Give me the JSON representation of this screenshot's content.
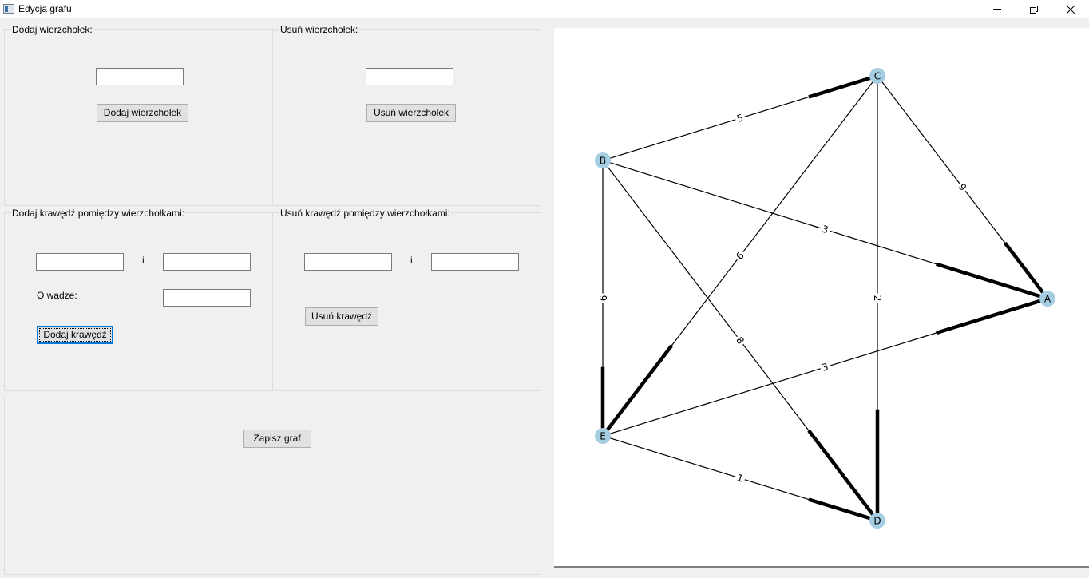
{
  "window": {
    "title": "Edycja grafu"
  },
  "add_vertex": {
    "title": "Dodaj wierzchołek:",
    "input_value": "",
    "button_label": "Dodaj wierzchołek"
  },
  "remove_vertex": {
    "title": "Usuń wierzchołek:",
    "input_value": "",
    "button_label": "Usuń wierzchołek"
  },
  "add_edge": {
    "title": "Dodaj krawędź pomiędzy wierzchołkami:",
    "from_value": "",
    "and_label": "i",
    "to_value": "",
    "weight_label": "O wadze:",
    "weight_value": "",
    "button_label": "Dodaj krawędź"
  },
  "remove_edge": {
    "title": "Usuń krawędź pomiędzy wierzchołkami:",
    "from_value": "",
    "and_label": "i",
    "to_value": "",
    "button_label": "Usuń krawędź"
  },
  "save": {
    "button_label": "Zapisz graf"
  },
  "graph": {
    "node_color": "#a6cee3",
    "edge_color": "#000000",
    "nodes": [
      {
        "id": "A",
        "label": "A"
      },
      {
        "id": "B",
        "label": "B"
      },
      {
        "id": "C",
        "label": "C"
      },
      {
        "id": "D",
        "label": "D"
      },
      {
        "id": "E",
        "label": "E"
      }
    ],
    "edges": [
      {
        "from": "B",
        "to": "C",
        "weight": "5"
      },
      {
        "from": "C",
        "to": "A",
        "weight": "9"
      },
      {
        "from": "B",
        "to": "A",
        "weight": "3"
      },
      {
        "from": "C",
        "to": "E",
        "weight": "6"
      },
      {
        "from": "C",
        "to": "D",
        "weight": "2"
      },
      {
        "from": "B",
        "to": "E",
        "weight": "9"
      },
      {
        "from": "B",
        "to": "D",
        "weight": "8"
      },
      {
        "from": "E",
        "to": "A",
        "weight": "3"
      },
      {
        "from": "E",
        "to": "D",
        "weight": "1"
      }
    ]
  }
}
